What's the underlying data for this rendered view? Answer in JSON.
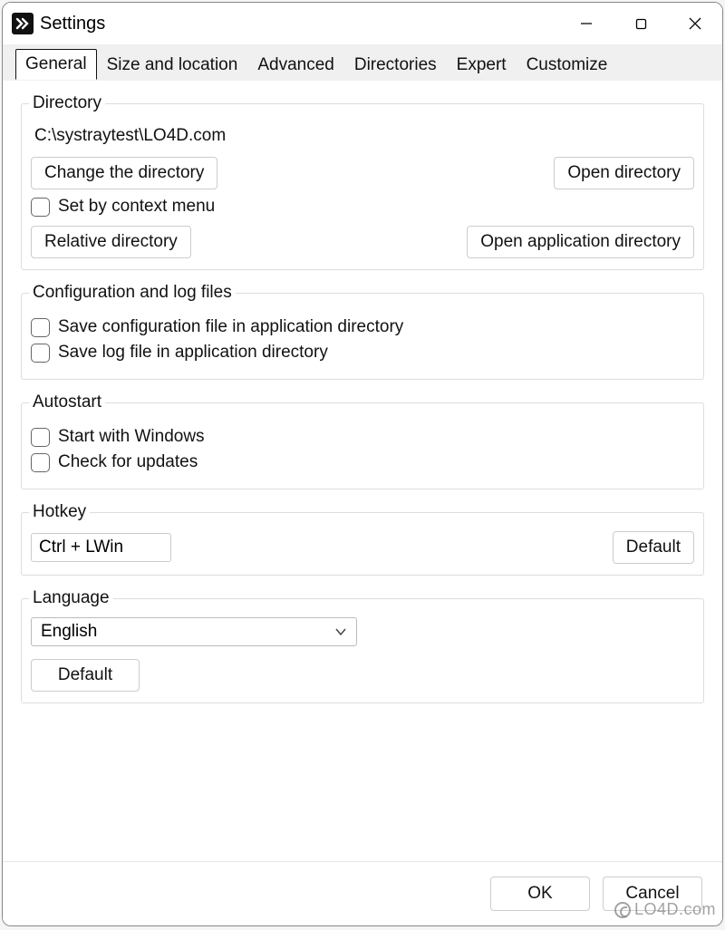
{
  "window": {
    "title": "Settings"
  },
  "tabs": {
    "general": "General",
    "size_location": "Size and location",
    "advanced": "Advanced",
    "directories": "Directories",
    "expert": "Expert",
    "customize": "Customize"
  },
  "groups": {
    "directory": {
      "legend": "Directory",
      "path": "C:\\systraytest\\LO4D.com",
      "change_btn": "Change the directory",
      "open_btn": "Open directory",
      "context_checkbox": "Set by context menu",
      "relative_btn": "Relative directory",
      "open_app_btn": "Open application directory"
    },
    "config": {
      "legend": "Configuration and log files",
      "save_config_checkbox": "Save configuration file in application directory",
      "save_log_checkbox": "Save log file in application directory"
    },
    "autostart": {
      "legend": "Autostart",
      "start_windows_checkbox": "Start with Windows",
      "check_updates_checkbox": "Check for updates"
    },
    "hotkey": {
      "legend": "Hotkey",
      "value": "Ctrl + LWin",
      "default_btn": "Default"
    },
    "language": {
      "legend": "Language",
      "value": "English",
      "default_btn": "Default"
    }
  },
  "footer": {
    "ok": "OK",
    "cancel": "Cancel"
  },
  "watermark": "LO4D.com"
}
